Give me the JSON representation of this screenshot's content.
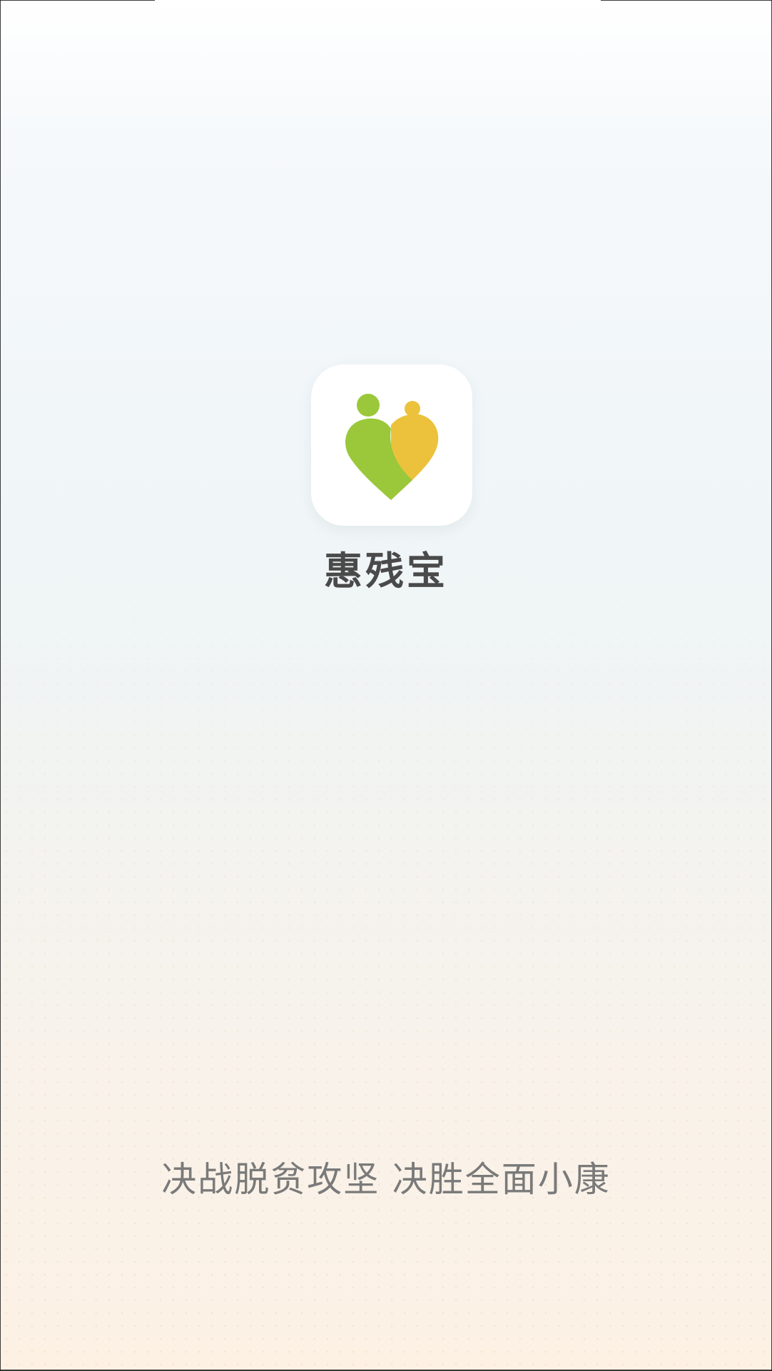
{
  "app": {
    "name": "惠残宝",
    "slogan": "决战脱贫攻坚 决胜全面小康",
    "icon": "heart-people-logo-icon"
  },
  "colors": {
    "logo_green": "#9ac83a",
    "logo_yellow": "#ecc23c",
    "app_name_text": "#4a4a4a",
    "slogan_text": "#7a7a7a",
    "background_top": "#ffffff",
    "background_bottom": "#fdf1e4"
  }
}
